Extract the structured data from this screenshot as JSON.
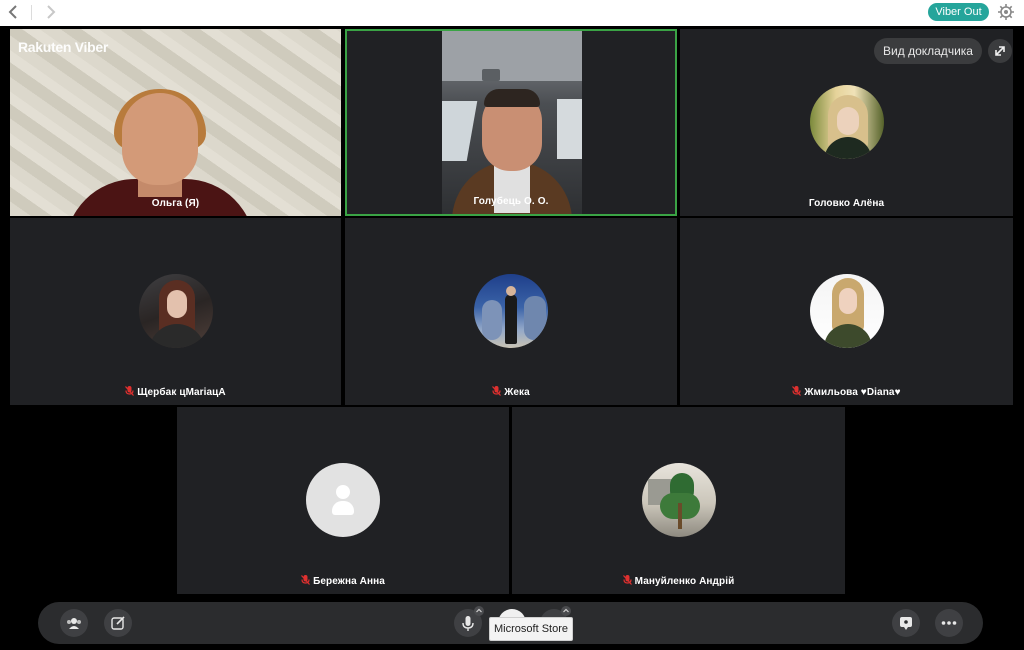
{
  "topbar": {
    "viber_out_label": "Viber Out"
  },
  "brand": {
    "logo_text": "Rakuten Viber"
  },
  "call": {
    "speaker_view_label": "Вид докладчика",
    "participants": [
      {
        "name": "Ольга (Я)",
        "muted": false,
        "mode": "video",
        "active_speaker": false
      },
      {
        "name": "Голубець О. О.",
        "muted": false,
        "mode": "video",
        "active_speaker": true
      },
      {
        "name": "Головко Алёна",
        "muted": false,
        "mode": "avatar",
        "active_speaker": false
      },
      {
        "name": "Щербак цMariaцА",
        "muted": true,
        "mode": "avatar",
        "active_speaker": false
      },
      {
        "name": "Жека",
        "muted": true,
        "mode": "avatar",
        "active_speaker": false
      },
      {
        "name": "Жмильова ♥Diana♥",
        "muted": true,
        "mode": "avatar",
        "active_speaker": false
      },
      {
        "name": "Бережна Анна",
        "muted": true,
        "mode": "avatar",
        "active_speaker": false
      },
      {
        "name": "Мануйленко Андрій",
        "muted": true,
        "mode": "avatar",
        "active_speaker": false
      }
    ]
  },
  "controls": {
    "tooltip": "Microsoft Store"
  },
  "colors": {
    "viber_out": "#25a59b",
    "tile_bg": "#202124",
    "active_border": "#3aa345",
    "mic_off": "#e0302f"
  },
  "icons": [
    "back-icon",
    "forward-icon",
    "settings-icon",
    "fullscreen-icon",
    "participants-icon",
    "edit-icon",
    "microphone-icon",
    "video-icon",
    "end-call-icon",
    "share-icon",
    "more-icon",
    "mic-off-icon"
  ]
}
